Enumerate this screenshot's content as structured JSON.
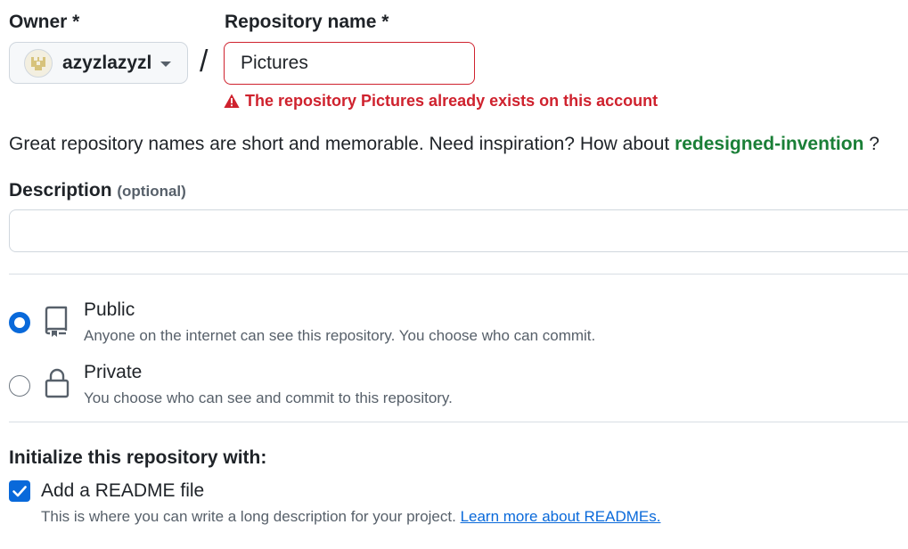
{
  "owner": {
    "label": "Owner *",
    "selected": "azyzlazyzl",
    "avatar_icon": "identicon-avatar"
  },
  "separator": "/",
  "repository": {
    "label": "Repository name *",
    "value": "Pictures",
    "error": "The repository Pictures already exists on this account",
    "error_icon": "alert-triangle-icon"
  },
  "suggestion": {
    "text": "Great repository names are short and memorable. Need inspiration? How about",
    "name": "redesigned-invention",
    "suffix": "?"
  },
  "description": {
    "label": "Description",
    "optional": "(optional)",
    "value": ""
  },
  "visibility": {
    "public": {
      "title": "Public",
      "desc": "Anyone on the internet can see this repository. You choose who can commit.",
      "icon": "repo-icon",
      "checked": true
    },
    "private": {
      "title": "Private",
      "desc": "You choose who can see and commit to this repository.",
      "icon": "lock-icon",
      "checked": false
    }
  },
  "initialize": {
    "label": "Initialize this repository with:",
    "readme_label": "Add a README file",
    "readme_checked": true,
    "readme_desc": "This is where you can write a long description for your project.",
    "readme_link": "Learn more about READMEs."
  },
  "colors": {
    "accent": "#0969da",
    "danger": "#cf222e",
    "success": "#1a7f37"
  }
}
